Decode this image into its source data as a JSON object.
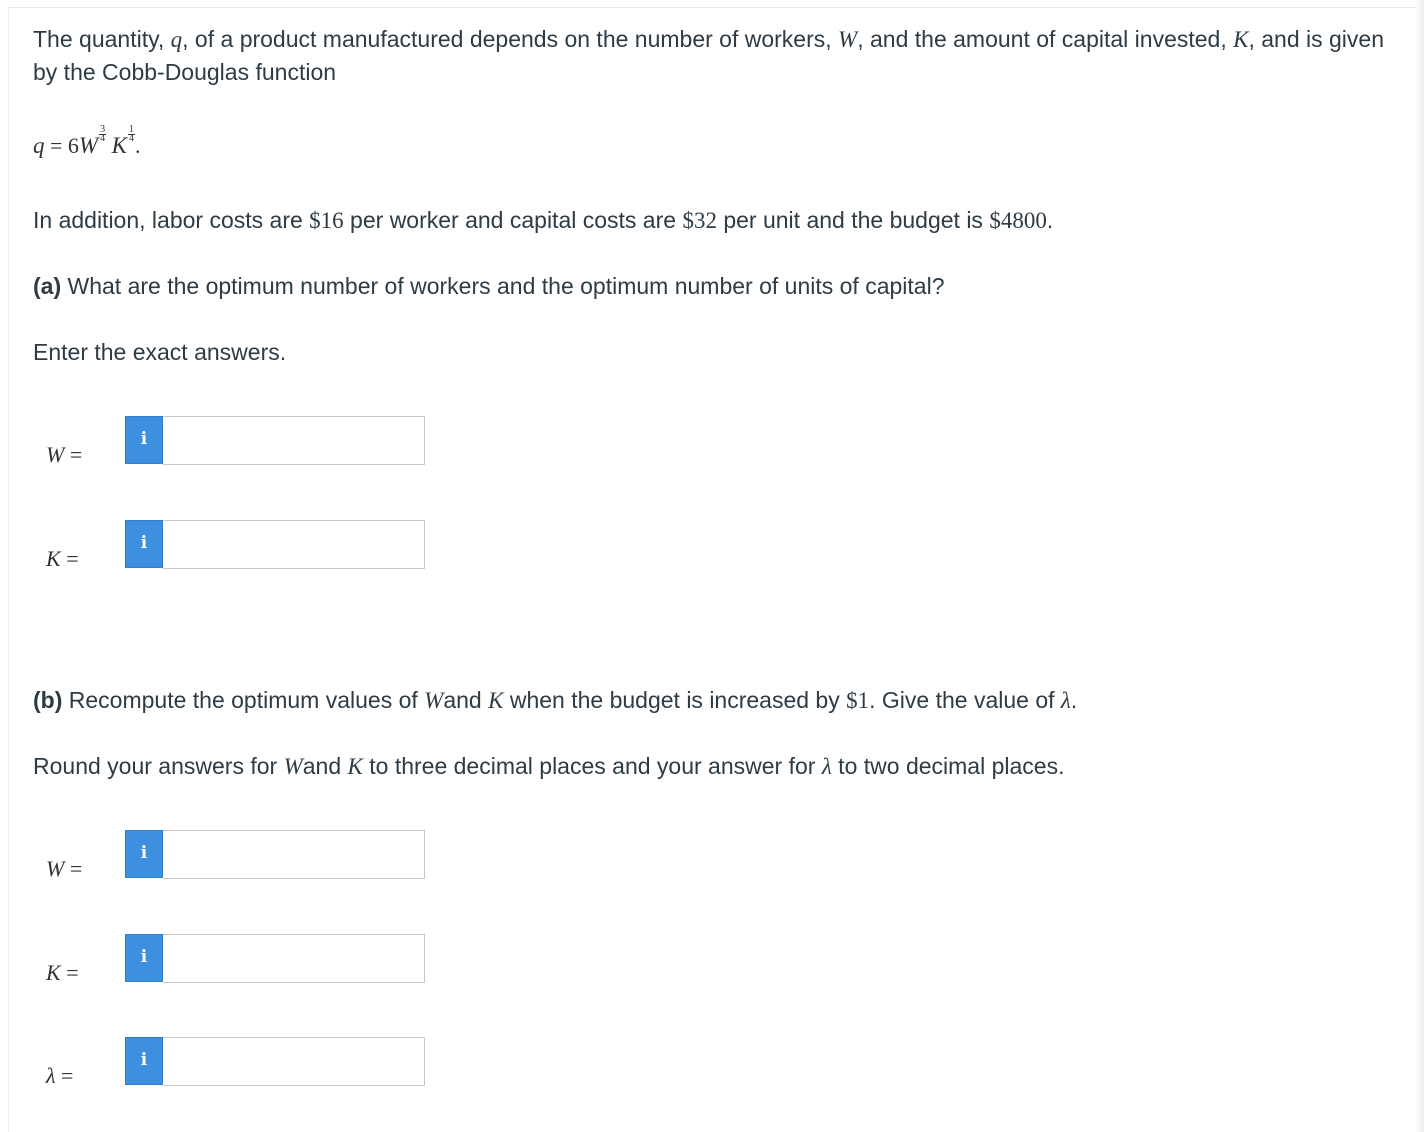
{
  "intro": {
    "line1_a": "The quantity, ",
    "var_q": "q",
    "line1_b": ", of a product manufactured depends on the number of workers, ",
    "var_W": "W",
    "line1_c": ", and the amount of capital invested, ",
    "var_K": "K",
    "line1_d": ", and is given",
    "line2": "by the Cobb-Douglas function"
  },
  "equation": {
    "lhs": "q",
    "eq": " = 6",
    "W": "W",
    "W_exp_num": "3",
    "W_exp_den": "4",
    "K": "K",
    "K_exp_num": "1",
    "K_exp_den": "4",
    "end": "."
  },
  "costs": {
    "a": "In addition, labor costs are ",
    "labor": "$16",
    "b": " per worker and capital costs are ",
    "capital": "$32",
    "c": " per unit and the budget is ",
    "budget": "$4800",
    "d": "."
  },
  "part_a": {
    "tag": "(a)",
    "question": " What are the optimum number of workers and the optimum number of units of capital?",
    "instruction": "Enter the exact answers.",
    "fields": [
      {
        "var": "W",
        "eq": " =",
        "value": ""
      },
      {
        "var": "K",
        "eq": " =",
        "value": ""
      }
    ]
  },
  "part_b": {
    "tag": "(b)",
    "q_a": " Recompute the optimum values of ",
    "q_W": "W",
    "q_b": "and ",
    "q_K": "K",
    "q_c": " when the budget is increased by ",
    "q_amt": "$1",
    "q_d": ". Give the value of ",
    "q_lambda": "λ",
    "q_e": ".",
    "r_a": "Round your answers for ",
    "r_W": "W",
    "r_b": "and ",
    "r_K": "K",
    "r_c": " to three decimal places and your answer for ",
    "r_lambda": "λ",
    "r_d": " to two decimal places.",
    "fields": [
      {
        "var": "W",
        "eq": " =",
        "value": ""
      },
      {
        "var": "K",
        "eq": " =",
        "value": ""
      },
      {
        "var": "λ",
        "eq": " =",
        "value": ""
      }
    ]
  },
  "info_icon_glyph": "i",
  "colors": {
    "info_button": "#3d8fe0",
    "text": "#2d3b45",
    "input_border": "#c8c8c8"
  }
}
